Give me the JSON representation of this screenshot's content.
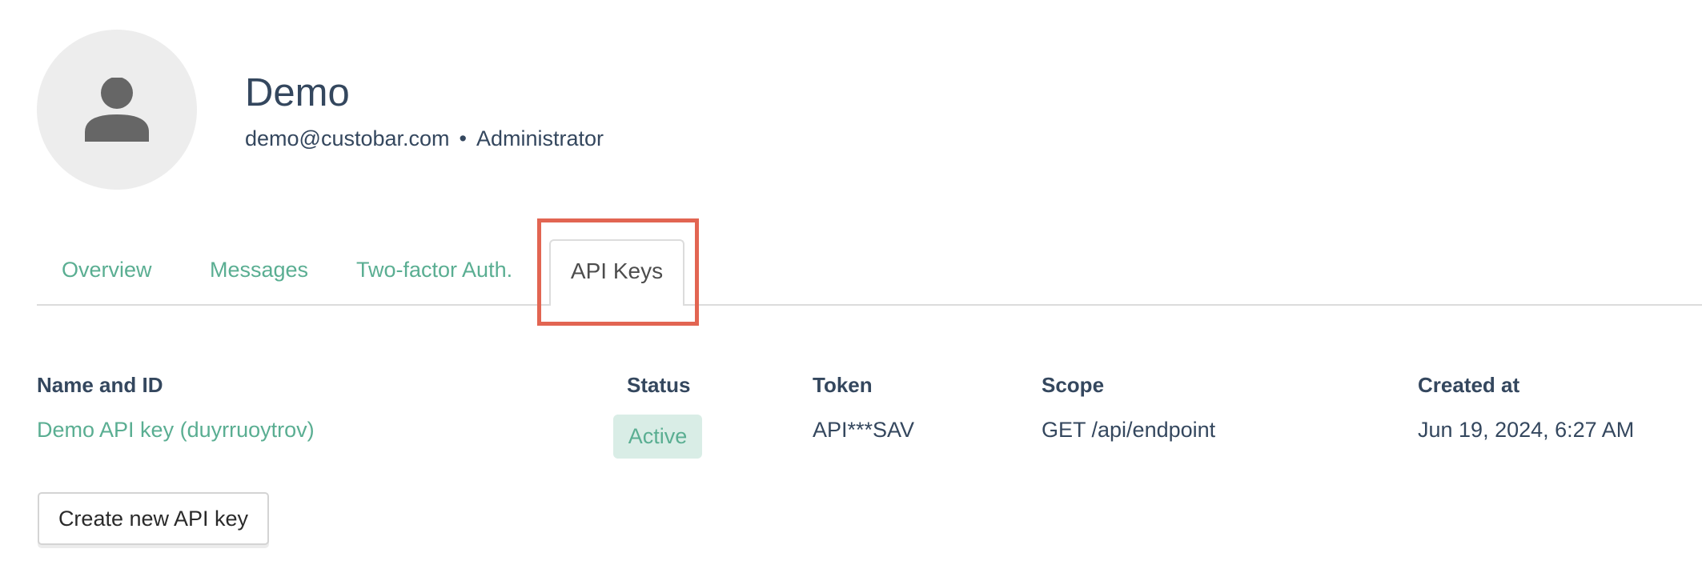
{
  "profile": {
    "name": "Demo",
    "email": "demo@custobar.com",
    "separator": "•",
    "role": "Administrator",
    "avatar_icon": "user-silhouette-icon"
  },
  "tabs": [
    {
      "label": "Overview",
      "active": false
    },
    {
      "label": "Messages",
      "active": false
    },
    {
      "label": "Two-factor Auth.",
      "active": false
    },
    {
      "label": "API Keys",
      "active": true
    }
  ],
  "api_keys": {
    "columns": [
      "Name and ID",
      "Status",
      "Token",
      "Scope",
      "Created at"
    ],
    "rows": [
      {
        "name_and_id": "Demo API key (duyrruoytrov)",
        "status": "Active",
        "token": "API***SAV",
        "scope": "GET /api/endpoint",
        "created_at": "Jun 19, 2024, 6:27 AM"
      }
    ],
    "create_button_label": "Create new API key"
  },
  "colors": {
    "accent": "#5aae92",
    "text": "#34475e",
    "highlight": "#e26552",
    "badge_bg": "#d9ede6"
  }
}
